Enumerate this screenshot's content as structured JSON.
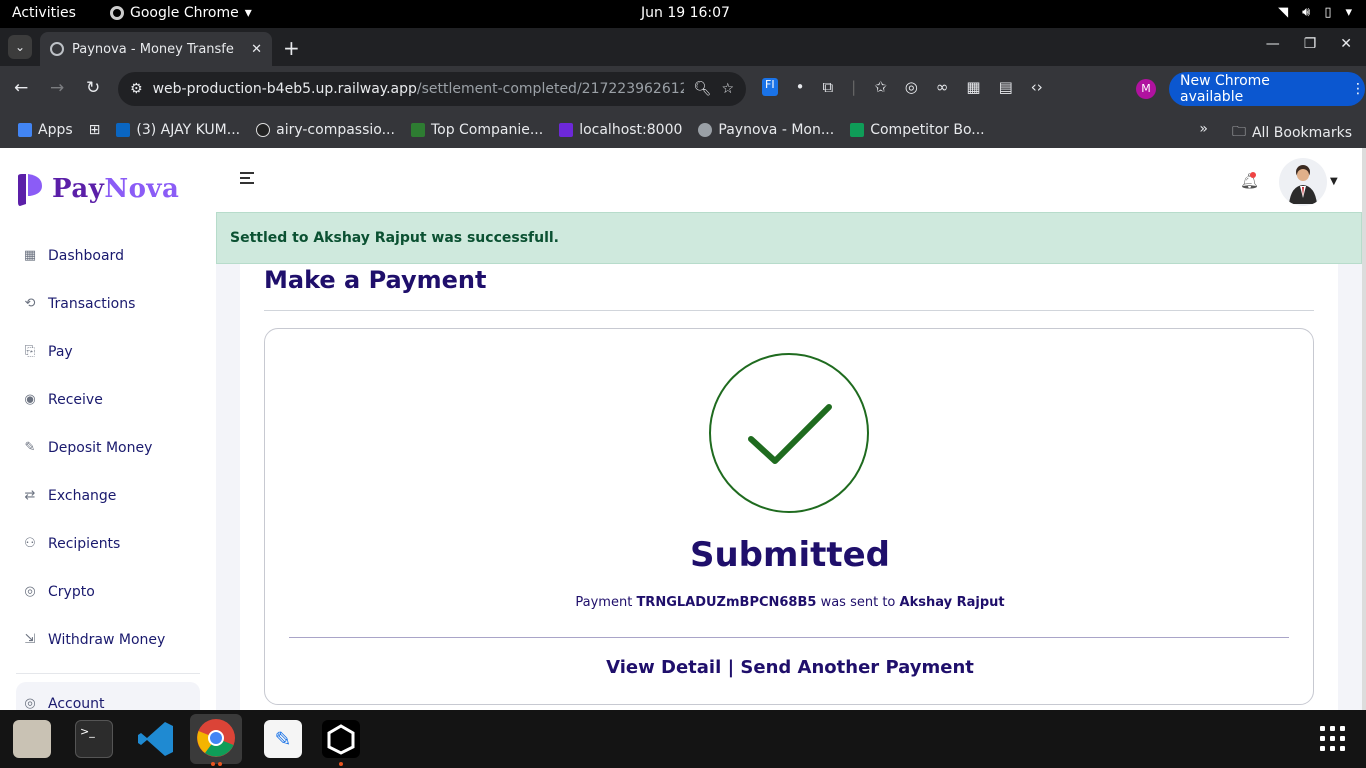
{
  "os": {
    "activities": "Activities",
    "app_name": "Google Chrome",
    "clock": "Jun 19  16:07"
  },
  "browser": {
    "tab_title": "Paynova - Money Transfe",
    "url_main": "web-production-b4eb5.up.railway.app",
    "url_path": "/settlement-completed/2172239626124/...",
    "profile_initial": "M",
    "update_label": "New Chrome available",
    "bookmarks": [
      {
        "label": "Apps",
        "color": "#4285f4"
      },
      {
        "label": "(3) AJAY KUM...",
        "color": "#0a66c2"
      },
      {
        "label": "airy-compassio...",
        "color": "#222222"
      },
      {
        "label": "Top Companie...",
        "color": "#2e7d32"
      },
      {
        "label": "localhost:8000",
        "color": "#6d28d9"
      },
      {
        "label": "Paynova - Mon...",
        "color": "#9aa0a6"
      },
      {
        "label": "Competitor Bo...",
        "color": "#0f9d58"
      }
    ],
    "all_bookmarks": "All Bookmarks"
  },
  "app": {
    "logo_pay": "Pay",
    "logo_nova": "Nova",
    "nav": [
      {
        "label": "Dashboard",
        "icon": "dashboard-icon"
      },
      {
        "label": "Transactions",
        "icon": "history-icon"
      },
      {
        "label": "Pay",
        "icon": "pay-icon"
      },
      {
        "label": "Receive",
        "icon": "receive-icon"
      },
      {
        "label": "Deposit Money",
        "icon": "deposit-icon"
      },
      {
        "label": "Exchange",
        "icon": "exchange-icon"
      },
      {
        "label": "Recipients",
        "icon": "user-icon"
      },
      {
        "label": "Crypto",
        "icon": "crypto-icon"
      },
      {
        "label": "Withdraw Money",
        "icon": "withdraw-icon"
      }
    ],
    "account_label": "Account",
    "alert_text": "Settled to Akshay Rajput was successfull.",
    "card_title": "Make a Payment",
    "status_title": "Submitted",
    "pay_prefix": "Payment",
    "transaction_id": "TRNGLADUZmBPCN68B5",
    "pay_middle": "was sent to",
    "recipient": "Akshay Rajput",
    "link_view": "View Detail",
    "link_separator": "|",
    "link_send": "Send Another Payment"
  }
}
